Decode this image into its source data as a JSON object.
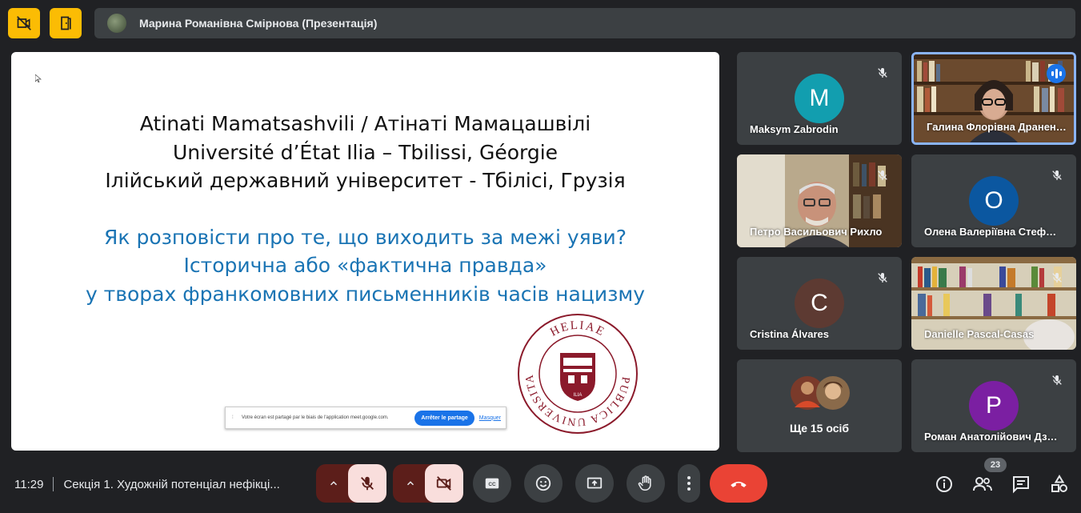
{
  "presenter": {
    "name": "Марина Романівна Смірнова (Презентація)"
  },
  "slide": {
    "lines": [
      "Atinati Mamatsashvili / Атінаті Мамацашвілі",
      "Université d’État Ilia – Tbilissi, Géorgie",
      "Ілійський державний університет - Тбілісі, Грузія"
    ],
    "title_lines": [
      "Як розповісти про те, що виходить за межі уяви?",
      "Історична або «фактична правда»",
      "у творах франкомовних письменників часів нацизму"
    ],
    "seal": {
      "top": "HELIAE",
      "left": "PUBLICA",
      "right": "UNIVERSITAS",
      "center": "ILIA"
    },
    "share_bar": {
      "text": "Votre écran est partagé par le biais de l'application meet.google.com.",
      "stop_label": "Arrêter le partage",
      "hide_label": "Masquer"
    }
  },
  "participants": [
    {
      "name": "Maksym Zabrodin",
      "initial": "M",
      "color": "#129eaf",
      "muted": true
    },
    {
      "name": "Галина Флорівна Дранен…",
      "video": true,
      "speaking": true
    },
    {
      "name": "Петро Васильович Рихло",
      "video": true,
      "muted": true
    },
    {
      "name": "Олена Валеріївна Стеф…",
      "initial": "O",
      "color": "#0b57a0",
      "muted": true
    },
    {
      "name": "Cristina Álvares",
      "initial": "C",
      "color": "#5d3a32",
      "muted": true
    },
    {
      "name": "Danielle Pascal-Casas",
      "video": true,
      "muted": true
    },
    {
      "more_label": "Ще 15 осіб"
    },
    {
      "name": "Роман Анатолійович Дз…",
      "initial": "P",
      "color": "#7b1fa2",
      "muted": true
    }
  ],
  "bottom": {
    "time": "11:29",
    "meeting": "Секція 1. Художній потенціал нефікці...",
    "people_count": "23"
  },
  "colors": {
    "end_call": "#ea4335",
    "muted_red": "#f9dedc",
    "alert_yellow": "#fbbc04",
    "active_border": "#8ab4f8"
  }
}
